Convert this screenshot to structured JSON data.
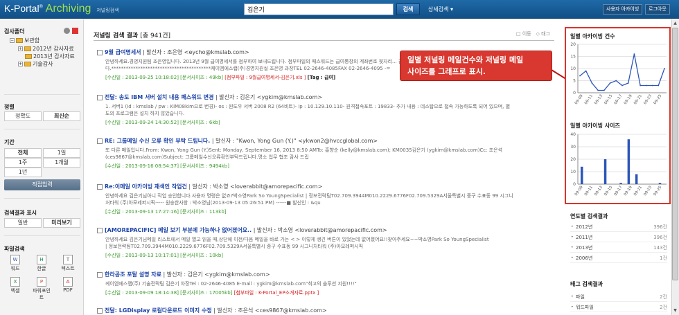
{
  "header": {
    "logo_main": "K-Portal",
    "logo_sup": "®",
    "logo_accent": "Archiving",
    "logo_sub": "저널링검색",
    "search_value": "김은기",
    "search_button": "검색",
    "advanced_search": "상세검색 ▾",
    "user_archive_btn": "사용자 아카이빙",
    "logout_btn": "로그아웃"
  },
  "sidebar": {
    "folder_title": "검사폴더",
    "tree": [
      "보관함",
      "2012년 감사자료",
      "2013년 감사자료",
      "기술감사"
    ],
    "sort_title": "정렬",
    "sort_options": [
      "정확도",
      "최신순"
    ],
    "period_title": "기간",
    "period_options": [
      "전체",
      "1일",
      "1주",
      "1개월",
      "1년"
    ],
    "direct_input": "직접입력",
    "display_title": "검색결과 표시",
    "display_options": [
      "일반",
      "미리보기"
    ],
    "file_title": "파일검색",
    "file_types": [
      "워드",
      "한글",
      "텍스트",
      "엑셀",
      "파워포인트",
      "PDF"
    ],
    "file_icon_names": [
      "word-icon",
      "hwp-icon",
      "text-icon",
      "excel-icon",
      "powerpoint-icon",
      "pdf-icon"
    ]
  },
  "main": {
    "title": "저널링 검색 결과",
    "count": "[총 941건]",
    "move_action": "이동",
    "tag_action": "태그"
  },
  "results": [
    {
      "title": "9월 급여명세서",
      "sender": "| 발신자 : 조은영 <eycho@kmslab.com>",
      "body": "안녕하세요.경영지원팀 조은영입니다. 2013년 9월 급여명세서를 첨부하여 보내드립니다. 첨부파일의 패스워드는 급여통장의 계좌번호 뒷자리... 감사합니다.",
      "body2": "다.*****************************************케이엠에스랩(주)경영지원실 조은영 과장TEL 02-2646-4085FAX 02-2646-4095 -=",
      "meta": "[수신일 : 2013-09-25 10:18:02] [문서사이즈 : 49kb]",
      "attach": "[첨부파일 : 9월급여명세서-김은기.xls ]",
      "tag": "[Tag : 급여]"
    },
    {
      "title": "전달: 송도 IBM 서버 설치 내용 패스워드 변경",
      "sender": "| 발신자 : 김은기 <ygkim@kmslab.com>",
      "body": "1. 서버1 (Id : kmslab / pw : KIM08kim으로 변경)- os : 윈도우 서버 2008 R2 (64비트)- ip : 10.129.10.110- 원격접속포트 : 19833- 추가 내용 : 데스탑으로 접속 가능하도록 되어 있으며, 별",
      "body2": "도의 프로그램은 설치 하지 않았습니다.",
      "meta": "[수신일 : 2013-09-24 14:30:52] [문서사이즈 : 6kb]",
      "attach": "",
      "tag": ""
    },
    {
      "title": "RE: 그룹메일 수신 오류 확인 부탁 드립니다.",
      "sender": "| 발신자 : \"Kwon, Yong Gun (Y.)\" <ykwon2@hvccglobal.com>",
      "body": "또 다른 메일입니다.From: Kwon, Yong Gun (Y.)Sent: Monday, September 16, 2013 8:50 AMTo: 홍향순 (kelly@kmslab.com); KM0035김은기 (ygkim@kmslab.com)Cc: 조은석",
      "body2": "(ces9867@kmslab.com)Subject: 그룹메일수신오류확인부탁드립니다.명소 업무 협조 감사 드립",
      "meta": "[수신일 : 2013-09-16 08:54:37] [문서사이즈 : 9494kb]",
      "attach": "",
      "tag": ""
    },
    {
      "title": "Re:이메일 아카이빙 재색인 작업건",
      "sender": "| 발신자 : 박소영 <loverabbit@amorepacific.com>",
      "body": "안녕하세요 김은기님아니 작업 승인합니다.사용자 명령은 없죠?박소영Park So YoungSpecialist | 정보전략팀T02.709.3944M010.2229.6776F02.709.5329A서울특별시 중구 수표동 99 시그니",
      "body2": "처타워 (주)아모레퍼시픽----- 원숭한사항 : 박소영님(2013-09-13 05:26:51 PM) ------■ 발신인 : &qu",
      "meta": "[수신일 : 2013-09-13 17:27:16] [문서사이즈 : 113kb]",
      "attach": "",
      "tag": ""
    },
    {
      "title": "[AMOREPACIFIC] 메일 보기 부분에 가능하나 없어졌어요..",
      "sender": "| 발신자 : 박소영 <loverabbit@amorepacific.com>",
      "body": "안녕하세요 김은기님메일 리스트에서 메일 열고 읽을 때,상단에 이전/다음 메일을 바로 가는 < > 이렇게 생긴 버튼이 있었는데 없어졌어요!!찾아주세요~~박소영Park So YoungSpecialist",
      "body2": "| 정보전략팀T02.709.3944M010.2229.6776F02.709.5329A서울특별시 중구 수표동 99 시그니처타워 (주)아모레퍼시픽",
      "meta": "[수신일 : 2013-09-13 10:17:01] [문서사이즈 : 10kb]",
      "attach": "",
      "tag": ""
    },
    {
      "title": "한라공조 포탈 설명 자료",
      "sender": "| 발신자 : 김은기 <ygkim@kmslab.com>",
      "body": "케이엠에스랩(주) 기술전략팀 김은기 차장Tel : 02-2646-4085 E-mail : ygkim@kmslab.com\"최고의 솔루션 지원!!!!\"",
      "body2": "",
      "meta": "[수신일 : 2013-09-09 18:14:38] [문서사이즈 : 17005kb]",
      "attach": "[첨부파일 : K-Portal_EP소개자료.pptx ]",
      "tag": ""
    },
    {
      "title": "전달: LGDisplay 로컬다운로드 이미지 수정",
      "sender": "| 발신자 : 조은석 <ces9867@kmslab.com>",
      "body": "",
      "body2": "",
      "meta": "",
      "attach": "",
      "tag": ""
    }
  ],
  "callout": {
    "line1": "일별 저널링 메일건수와 저널링 메일",
    "line2": "사이즈를 그래프로 표시."
  },
  "right": {
    "year_title": "연도별 검색결과",
    "years": [
      {
        "label": "2012년",
        "count": "396건"
      },
      {
        "label": "2011년",
        "count": "396건"
      },
      {
        "label": "2013년",
        "count": "143건"
      },
      {
        "label": "2006년",
        "count": "1건"
      }
    ],
    "tag_title": "태그 검색결과",
    "tags": [
      {
        "label": "파일",
        "count": "2건"
      },
      {
        "label": "워드파일",
        "count": "2건"
      }
    ]
  },
  "chart_data": [
    {
      "type": "line",
      "title": "일별 아카이빙 건수",
      "categories": [
        "09-09",
        "09-11",
        "09-13",
        "09-15",
        "09-17",
        "09-19",
        "09-21",
        "09-23",
        "09-25"
      ],
      "x": [
        "09-09",
        "09-10",
        "09-11",
        "09-12",
        "09-13",
        "09-14",
        "09-15",
        "09-16",
        "09-17",
        "09-18",
        "09-19",
        "09-20",
        "09-21",
        "09-22",
        "09-23",
        "09-24",
        "09-25",
        "09-26"
      ],
      "values": [
        7,
        9,
        4,
        1,
        1,
        4,
        5,
        3,
        4,
        16,
        3,
        3,
        3,
        3,
        10
      ],
      "ylim": [
        0,
        20
      ],
      "yticks": [
        0,
        5,
        10,
        15,
        20
      ],
      "color": "#2b55b8"
    },
    {
      "type": "bar",
      "title": "일별 아카이빙 사이즈",
      "categories": [
        "09-09",
        "09-11",
        "09-13",
        "09-15",
        "09-17",
        "09-19",
        "09-21",
        "09-23",
        "09-25"
      ],
      "values": [
        14,
        0,
        0,
        20,
        0,
        1,
        36,
        8,
        0,
        0,
        1
      ],
      "ylim": [
        0,
        40
      ],
      "yticks": [
        0,
        10,
        20,
        30,
        40
      ],
      "color": "#2b55b8"
    }
  ]
}
